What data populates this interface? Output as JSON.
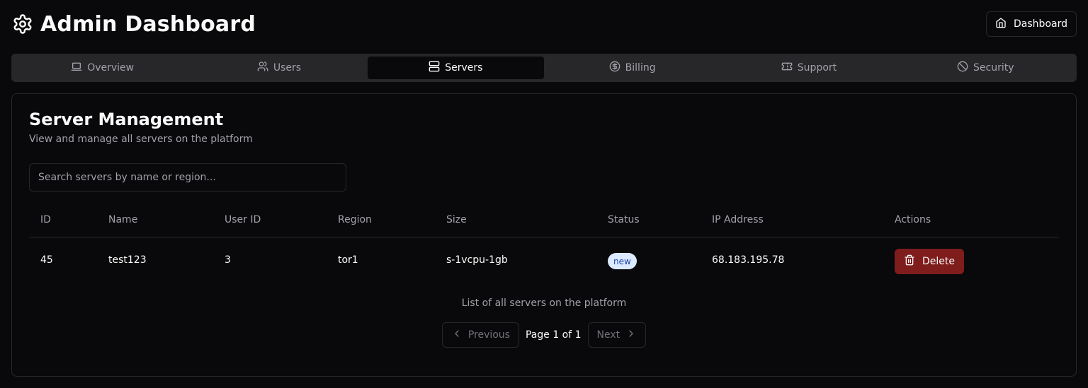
{
  "app": {
    "title": "Admin Dashboard",
    "dashboard_button": "Dashboard"
  },
  "tabs": [
    {
      "label": "Overview",
      "icon": "laptop-icon",
      "active": false
    },
    {
      "label": "Users",
      "icon": "users-icon",
      "active": false
    },
    {
      "label": "Servers",
      "icon": "server-icon",
      "active": true
    },
    {
      "label": "Billing",
      "icon": "dollar-circle-icon",
      "active": false
    },
    {
      "label": "Support",
      "icon": "ticket-icon",
      "active": false
    },
    {
      "label": "Security",
      "icon": "ban-icon",
      "active": false
    }
  ],
  "servers": {
    "title": "Server Management",
    "subtitle": "View and manage all servers on the platform",
    "search_placeholder": "Search servers by name or region...",
    "search_value": "",
    "columns": [
      "ID",
      "Name",
      "User ID",
      "Region",
      "Size",
      "Status",
      "IP Address",
      "Actions"
    ],
    "rows": [
      {
        "id": "45",
        "name": "test123",
        "user_id": "3",
        "region": "tor1",
        "size": "s-1vcpu-1gb",
        "status": "new",
        "ip": "68.183.195.78",
        "action": "Delete"
      }
    ],
    "caption": "List of all servers on the platform",
    "pagination": {
      "previous": "Previous",
      "page_info": "Page 1 of 1",
      "next": "Next"
    }
  },
  "colors": {
    "background": "#09090b",
    "border": "#27272a",
    "muted_text": "#a1a1aa",
    "delete": "#7f1d1d",
    "badge_bg": "#dbeafe",
    "badge_text": "#1e40af"
  }
}
